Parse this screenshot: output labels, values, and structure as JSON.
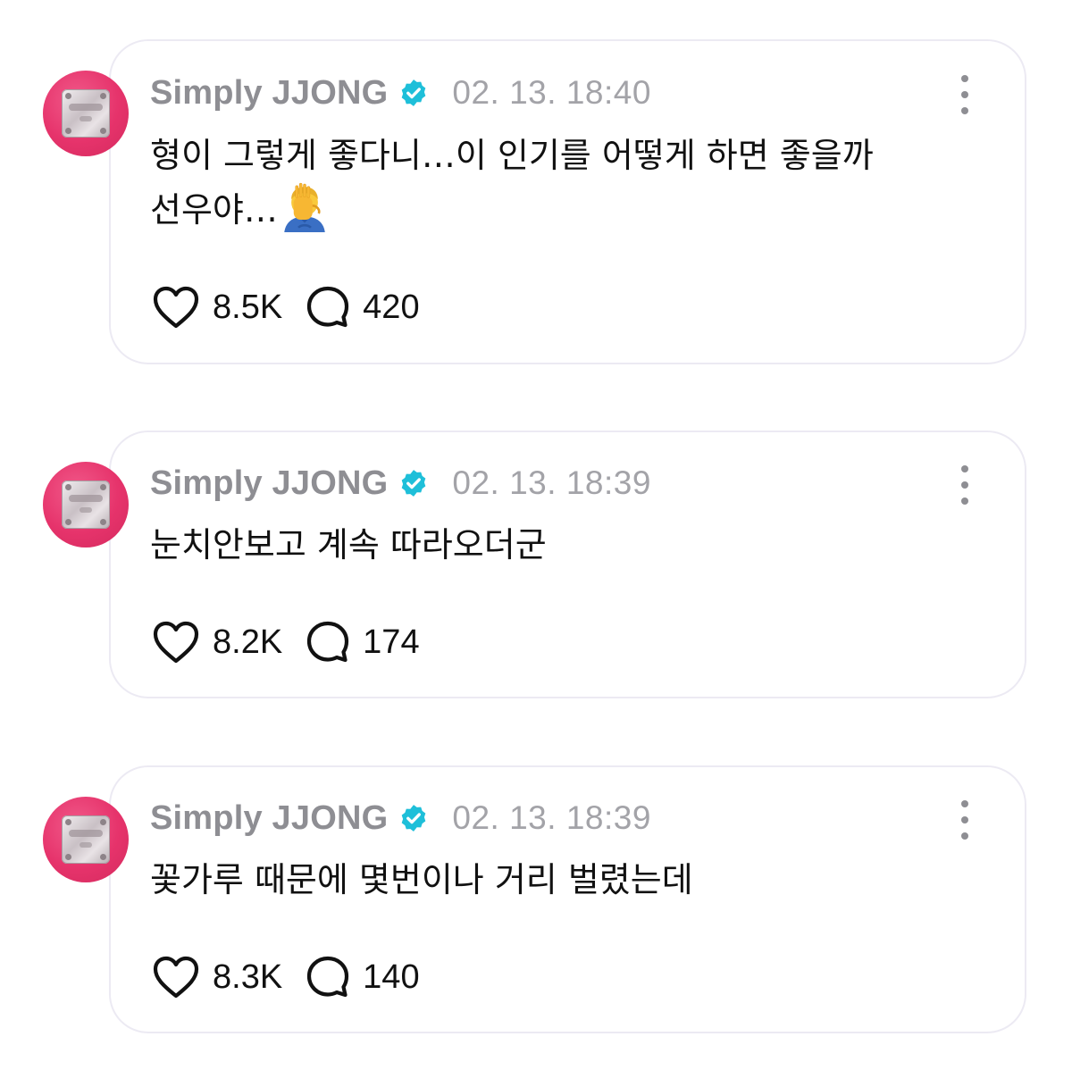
{
  "posts": [
    {
      "author": "Simply JJONG",
      "verified": true,
      "timestamp": "02. 13. 18:40",
      "text": "형이 그렇게 좋다니…이 인기를 어떻게 하면 좋을까\n선우야…",
      "emoji": "facepalm-icon",
      "likes": "8.5K",
      "comments": "420"
    },
    {
      "author": "Simply JJONG",
      "verified": true,
      "timestamp": "02. 13. 18:39",
      "text": "눈치안보고 계속 따라오더군",
      "likes": "8.2K",
      "comments": "174"
    },
    {
      "author": "Simply JJONG",
      "verified": true,
      "timestamp": "02. 13. 18:39",
      "text": "꽃가루 때문에 몇번이나 거리 벌렸는데",
      "likes": "8.3K",
      "comments": "140"
    }
  ],
  "colors": {
    "verified_badge": "#1ebfd9",
    "card_border": "#eceaf3",
    "author_text": "#8e8e93",
    "timestamp_text": "#a3a3a8",
    "avatar_bg": "#e6336b"
  }
}
